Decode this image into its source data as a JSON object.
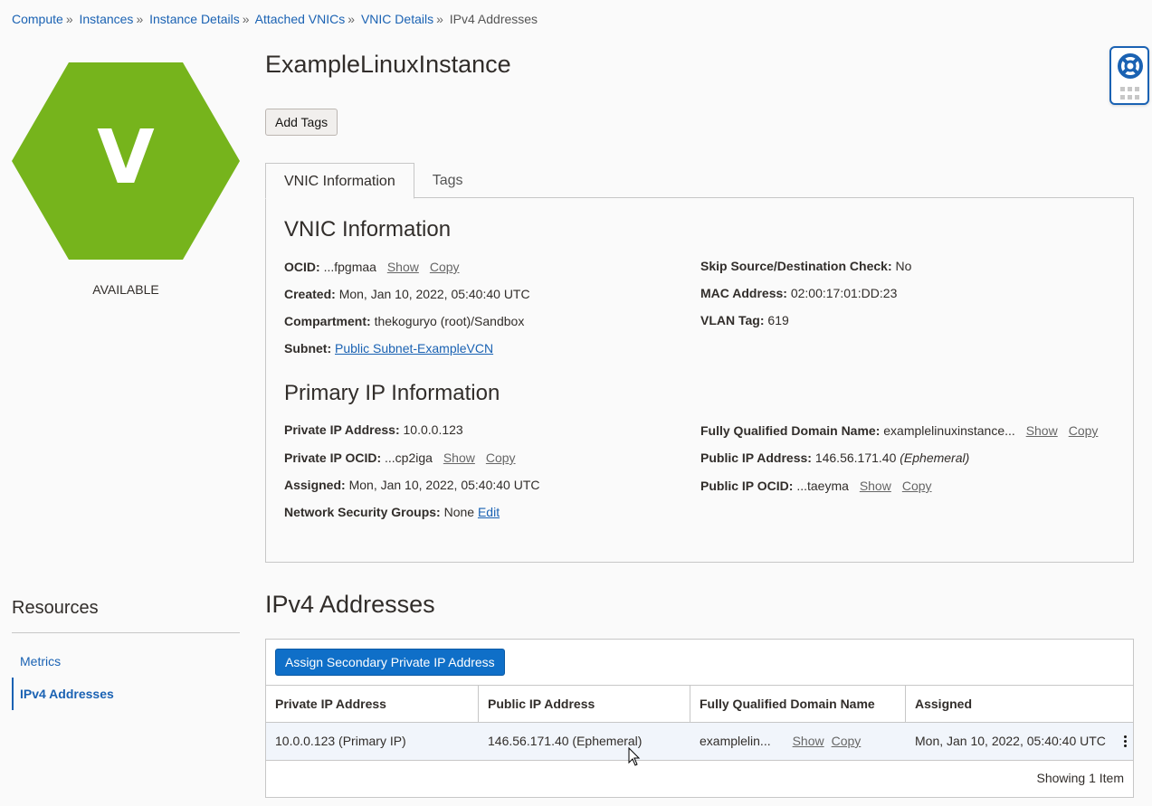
{
  "breadcrumb": {
    "items": [
      "Compute",
      "Instances",
      "Instance Details",
      "Attached VNICs",
      "VNIC Details"
    ],
    "current": "IPv4 Addresses",
    "separator": "»"
  },
  "instance": {
    "icon_letter": "V",
    "state": "AVAILABLE",
    "state_color": "#76b41c",
    "name": "ExampleLinuxInstance",
    "add_tags_label": "Add Tags"
  },
  "tabs": [
    {
      "label": "VNIC Information",
      "active": true
    },
    {
      "label": "Tags",
      "active": false
    }
  ],
  "vnic_info": {
    "heading": "VNIC Information",
    "ocid_label": "OCID:",
    "ocid_value": "...fpgmaa",
    "created_label": "Created:",
    "created_value": "Mon, Jan 10, 2022, 05:40:40 UTC",
    "compartment_label": "Compartment:",
    "compartment_value": "thekoguryo (root)/Sandbox",
    "subnet_label": "Subnet:",
    "subnet_value": "Public Subnet-ExampleVCN",
    "skip_label": "Skip Source/Destination Check:",
    "skip_value": "No",
    "mac_label": "MAC Address:",
    "mac_value": "02:00:17:01:DD:23",
    "vlan_label": "VLAN Tag:",
    "vlan_value": "619"
  },
  "primary_ip": {
    "heading": "Primary IP Information",
    "private_ip_label": "Private IP Address:",
    "private_ip_value": "10.0.0.123",
    "private_ocid_label": "Private IP OCID:",
    "private_ocid_value": "...cp2iga",
    "assigned_label": "Assigned:",
    "assigned_value": "Mon, Jan 10, 2022, 05:40:40 UTC",
    "nsg_label": "Network Security Groups:",
    "nsg_value": "None",
    "nsg_edit": "Edit",
    "fqdn_label": "Fully Qualified Domain Name:",
    "fqdn_value": "examplelinuxinstance...",
    "public_ip_label": "Public IP Address:",
    "public_ip_value": "146.56.171.40",
    "public_ip_type": "(Ephemeral)",
    "public_ocid_label": "Public IP OCID:",
    "public_ocid_value": "...taeyma"
  },
  "actions": {
    "show": "Show",
    "copy": "Copy"
  },
  "resources": {
    "title": "Resources",
    "items": [
      {
        "label": "Metrics",
        "active": false
      },
      {
        "label": "IPv4 Addresses",
        "active": true
      }
    ]
  },
  "ipv4": {
    "title": "IPv4 Addresses",
    "assign_button": "Assign Secondary Private IP Address",
    "columns": [
      "Private IP Address",
      "Public IP Address",
      "Fully Qualified Domain Name",
      "Assigned"
    ],
    "rows": [
      {
        "private_ip": "10.0.0.123 (Primary IP)",
        "public_ip": "146.56.171.40 (Ephemeral)",
        "fqdn": "examplelin...",
        "assigned": "Mon, Jan 10, 2022, 05:40:40 UTC"
      }
    ],
    "footer": "Showing 1 Item"
  },
  "colors": {
    "link": "#1a62b3",
    "primary_button": "#0f6fc8",
    "hexagon": "#76b41c",
    "selected_row": "#f1f5fb"
  }
}
